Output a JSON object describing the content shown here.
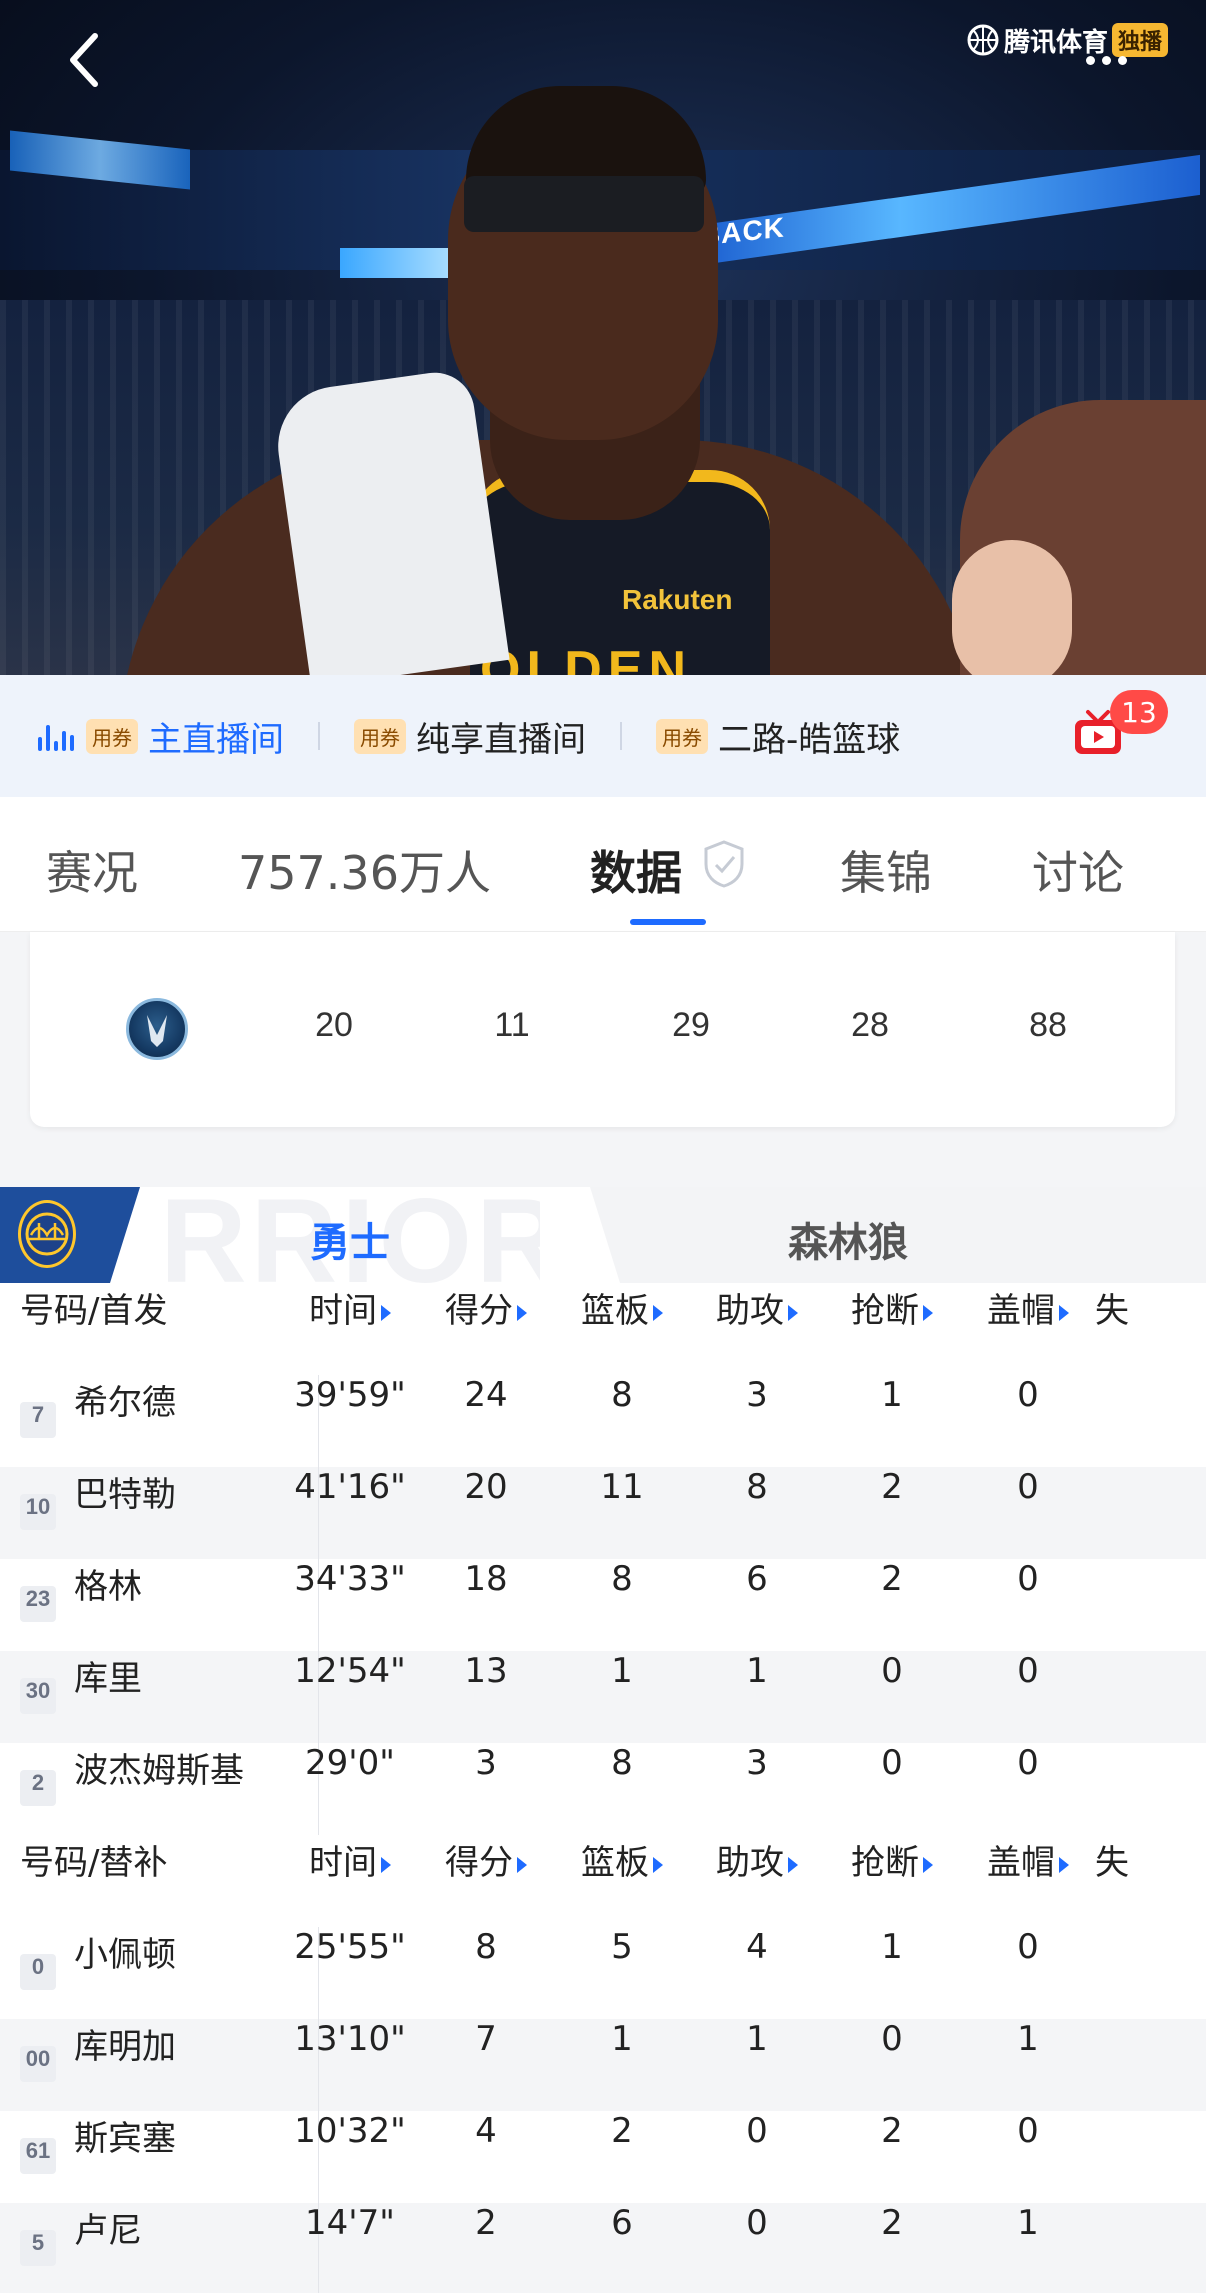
{
  "video": {
    "brand_text": "腾讯体育",
    "brand_badge": "独播",
    "arena_sign": "BACK",
    "jersey_sponsor": "Rakuten",
    "jersey_text": "OLDEN"
  },
  "channels": {
    "items": [
      {
        "coupon": "用券",
        "label": "主直播间",
        "active": true
      },
      {
        "coupon": "用券",
        "label": "纯享直播间",
        "active": false
      },
      {
        "coupon": "用券",
        "label": "二路-皓篮球",
        "active": false
      }
    ],
    "badge_count": "13"
  },
  "tabs": [
    "赛况",
    "757.36万人",
    "数据",
    "集锦",
    "讨论"
  ],
  "score_row": {
    "team_logo": "timberwolves-logo",
    "quarters": [
      "20",
      "11",
      "29",
      "28",
      "88"
    ]
  },
  "team_tabs": {
    "home": "勇士",
    "away": "森林狼",
    "bg_word": "RRIORS"
  },
  "table": {
    "starters_header": [
      "号码/首发",
      "时间",
      "得分",
      "篮板",
      "助攻",
      "抢断",
      "盖帽",
      "失"
    ],
    "bench_header": [
      "号码/替补",
      "时间",
      "得分",
      "篮板",
      "助攻",
      "抢断",
      "盖帽",
      "失"
    ],
    "starters": [
      {
        "num": "7",
        "name": "希尔德",
        "min": "39'59\"",
        "pts": "24",
        "reb": "8",
        "ast": "3",
        "stl": "1",
        "blk": "0"
      },
      {
        "num": "10",
        "name": "巴特勒",
        "min": "41'16\"",
        "pts": "20",
        "reb": "11",
        "ast": "8",
        "stl": "2",
        "blk": "0"
      },
      {
        "num": "23",
        "name": "格林",
        "min": "34'33\"",
        "pts": "18",
        "reb": "8",
        "ast": "6",
        "stl": "2",
        "blk": "0"
      },
      {
        "num": "30",
        "name": "库里",
        "min": "12'54\"",
        "pts": "13",
        "reb": "1",
        "ast": "1",
        "stl": "0",
        "blk": "0"
      },
      {
        "num": "2",
        "name": "波杰姆斯基",
        "min": "29'0\"",
        "pts": "3",
        "reb": "8",
        "ast": "3",
        "stl": "0",
        "blk": "0"
      }
    ],
    "bench": [
      {
        "num": "0",
        "name": "小佩顿",
        "min": "25'55\"",
        "pts": "8",
        "reb": "5",
        "ast": "4",
        "stl": "1",
        "blk": "0"
      },
      {
        "num": "00",
        "name": "库明加",
        "min": "13'10\"",
        "pts": "7",
        "reb": "1",
        "ast": "1",
        "stl": "0",
        "blk": "1"
      },
      {
        "num": "61",
        "name": "斯宾塞",
        "min": "10'32\"",
        "pts": "4",
        "reb": "2",
        "ast": "0",
        "stl": "2",
        "blk": "0"
      },
      {
        "num": "5",
        "name": "卢尼",
        "min": "14'7\"",
        "pts": "2",
        "reb": "6",
        "ast": "0",
        "stl": "2",
        "blk": "1"
      }
    ]
  },
  "colors": {
    "accent": "#1e6bff",
    "badge_red": "#ff4a47",
    "coupon_bg": "#ffe0b2",
    "warriors_blue": "#1d428a",
    "warriors_gold": "#ffc72c"
  }
}
